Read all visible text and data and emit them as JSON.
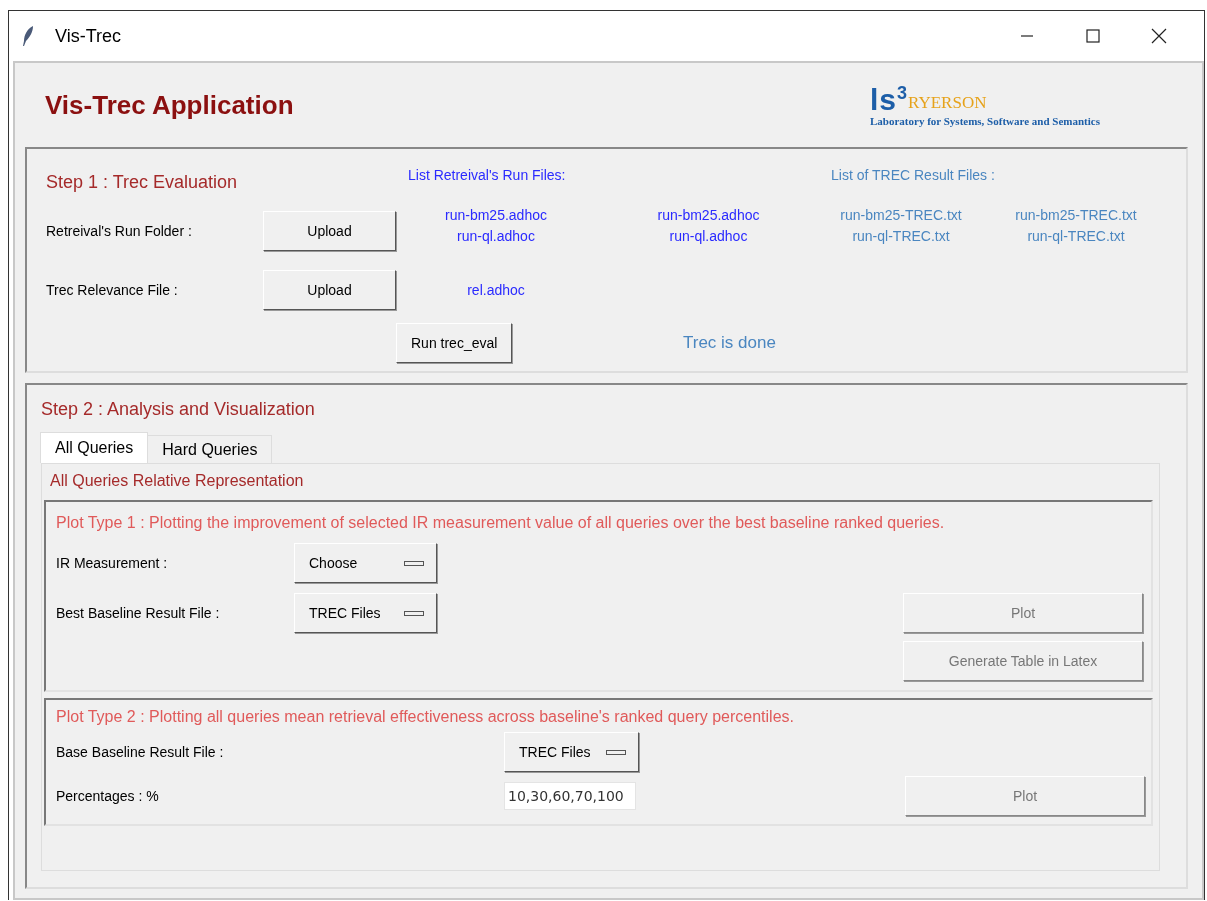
{
  "window": {
    "title": "Vis-Trec"
  },
  "header": {
    "title": "Vis-Trec Application",
    "logo": {
      "mark": "ls$^{3}$",
      "name": "RYERSON",
      "subtitle": "Laboratory for Systems, Software and Semantics"
    }
  },
  "step1": {
    "title": "Step 1 : Trec Evaluation",
    "run_files_heading": "List Retreival's Run Files:",
    "result_files_heading": "List of TREC Result Files :",
    "run_folder": {
      "label": "Retreival's Run Folder :",
      "button": {
        "label": "Upload",
        "disabled": false
      }
    },
    "run_files_columns": [
      [
        "run-bm25.adhoc",
        "run-ql.adhoc"
      ],
      [
        "run-bm25.adhoc",
        "run-ql.adhoc"
      ]
    ],
    "result_files_columns": [
      [
        "run-bm25-TREC.txt",
        "run-ql-TREC.txt"
      ],
      [
        "run-bm25-TREC.txt",
        "run-ql-TREC.txt"
      ]
    ],
    "relevance": {
      "label": "Trec Relevance File :",
      "button": {
        "label": "Upload",
        "disabled": false
      },
      "file": "rel.adhoc"
    },
    "run_button": {
      "label": "Run trec_eval",
      "disabled": false
    },
    "status": "Trec is done"
  },
  "step2": {
    "title": "Step 2 : Analysis and Visualization",
    "tabs": [
      {
        "label": "All Queries",
        "selected": true
      },
      {
        "label": "Hard Queries",
        "selected": false
      }
    ],
    "panel_title": "All Queries Relative Representation",
    "plot_type_1": {
      "title": "Plot Type 1 :  Plotting the improvement of selected IR measurement value of all queries over the best baseline ranked queries.",
      "ir_measurement": {
        "label": "IR Measurement :",
        "value": "Choose"
      },
      "best_baseline": {
        "label": "Best Baseline Result File :",
        "value": "TREC Files"
      },
      "plot_button": {
        "label": "Plot",
        "disabled": true
      },
      "latex_button": {
        "label": "Generate Table in Latex",
        "disabled": true
      }
    },
    "plot_type_2": {
      "title": "Plot Type 2 :  Plotting all queries mean retrieval effectiveness across baseline's ranked query percentiles.",
      "base_baseline": {
        "label": "Base Baseline Result File :",
        "value": "TREC Files"
      },
      "percentages": {
        "label": "Percentages : %",
        "value": "10,30,60,70,100"
      },
      "plot_button": {
        "label": "Plot",
        "disabled": true
      }
    }
  }
}
